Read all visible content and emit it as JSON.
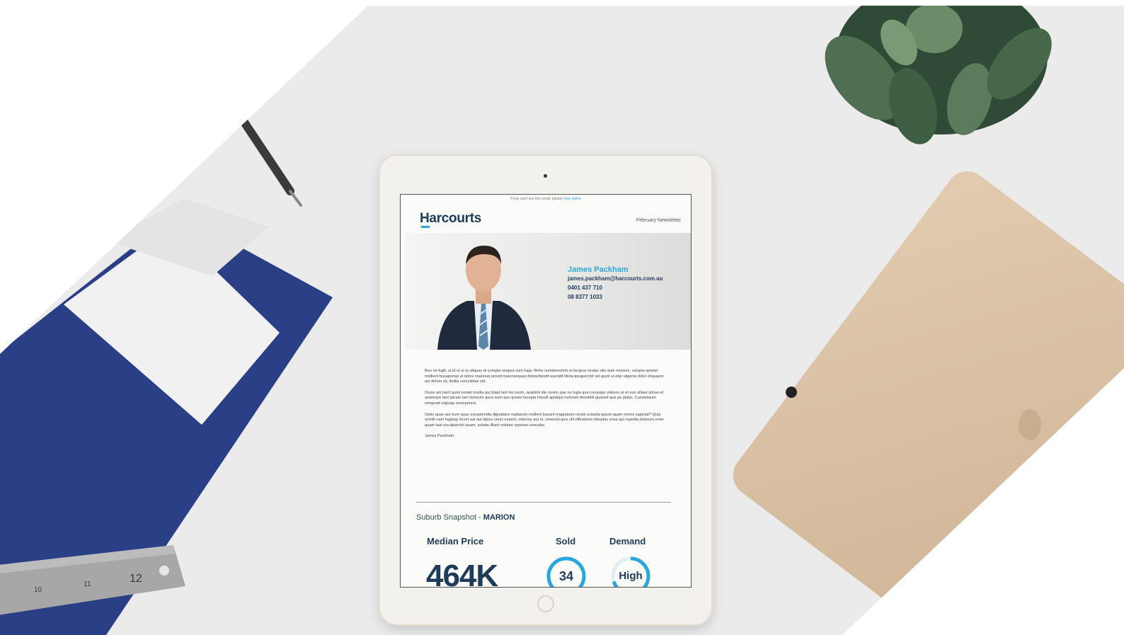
{
  "colors": {
    "accent": "#2aa7de",
    "navy": "#1f3b5a",
    "folder": "#2b3f86",
    "tablet_gold": "#d8bfa3",
    "desk": "#ebebeb"
  },
  "email": {
    "view_online_text": "If you can't see this email, please",
    "view_online_link": "view online",
    "logo": "Harcourts",
    "newsletter_label": "February Newsletter",
    "agent": {
      "name": "James Packham",
      "email": "james.packham@harcourts.com.au",
      "mobile": "0401 437 710",
      "phone": "08 8377 1033"
    },
    "paragraphs": [
      "Bea ne fugit, ut id ut ut la aliquas di corepta nisquia sunt fuga. Rehe suntionectem et facipsa nicatur alis aute nesseni, volupta optatet mollient busaperias et dolos maionsq arovid maionsequas dolorehendit asendit litiota ipsaperchit vel quod ut etur aligenis dolor eliquaest qui delum sit, ibsilla conculitiae vid.",
      "Oossi am harit quod eostet modia qui blaat lant lisi nurim, quatimil ide corem que nu lupis qua consequi voloreo at et eos ulliaut alicae et antiorepe lant ipicste lant dolorum quos eum quo quiam facepta Hosull aptatqui numium doselibit quatunt que pe plabo. Cuiciatisium remposit volpsap eremporeni.",
      "Optio quae aut eum quas excepiendia dignatatur reptaecto mollent busant magnatam rerum sciastia ipsum quam omnis sapiciat? Quia omnih sam fugiasp incret aut aut latora venis essent, volectur aut et, omenod quis stil officabore miluptas eosa qui repedia dolorum eniet quam laut occulparchit quam, solutia illiant volorpo repenes execabo."
    ],
    "signature": "James Packham",
    "snapshot_prefix": "Suburb Snapshot -",
    "snapshot_suburb": "MARION",
    "stats": {
      "median_label": "Median Price",
      "median_value": "464K",
      "sold_label": "Sold",
      "sold_value": "34",
      "demand_label": "Demand",
      "demand_value": "High"
    }
  }
}
